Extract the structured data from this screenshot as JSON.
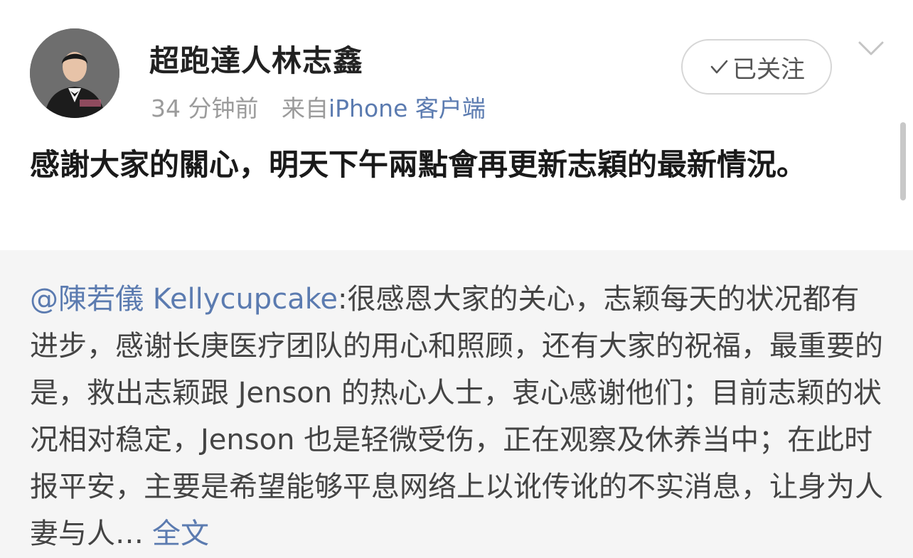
{
  "post": {
    "author": "超跑達人林志鑫",
    "time": "34 分钟前",
    "source_prefix": "来自",
    "source": "iPhone 客户端",
    "follow_label": "已关注",
    "text": "感謝大家的關心，明天下午兩點會再更新志穎的最新情況。"
  },
  "repost": {
    "mention": "@陳若儀 Kellycupcake",
    "text": ":很感恩大家的关心，志颖每天的状况都有进步，感谢长庚医疗团队的用心和照顾，还有大家的祝福，最重要的是，救出志颖跟 Jenson 的热心人士，衷心感谢他们；目前志颖的状况相对稳定，Jenson 也是轻微受伤，正在观察及休养当中；在此时报平安，主要是希望能够平息网络上以讹传讹的不实消息，让身为人妻与人…",
    "more_label": "全文"
  },
  "icons": {
    "avatar": "profile-photo",
    "follow": "check-icon",
    "menu": "chevron-down-icon"
  },
  "colors": {
    "link": "#5b7bb0",
    "repost_bg": "#f5f5f5"
  }
}
